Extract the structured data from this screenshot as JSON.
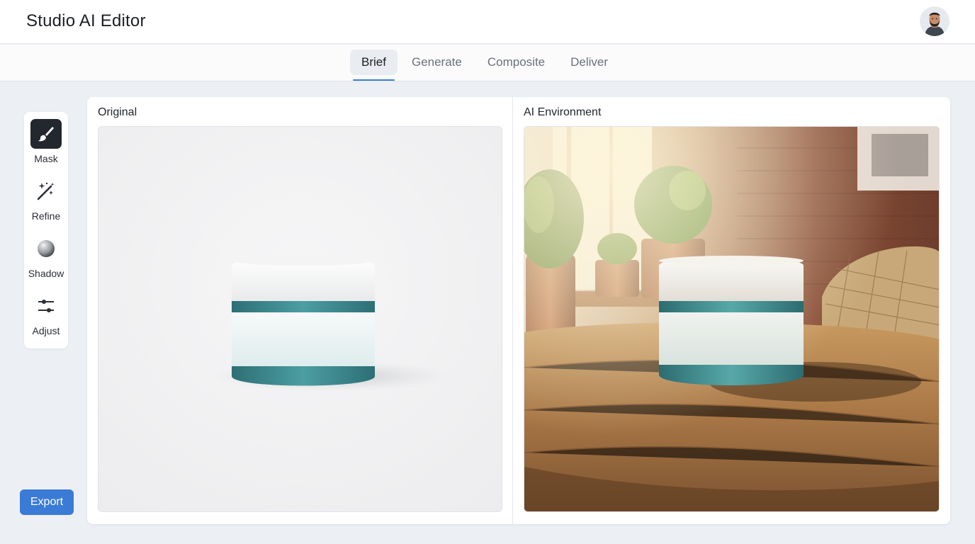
{
  "app": {
    "title": "Studio AI Editor"
  },
  "user": {
    "avatar_icon": "user-avatar"
  },
  "tabs": [
    {
      "label": "Brief",
      "active": true
    },
    {
      "label": "Generate",
      "active": false
    },
    {
      "label": "Composite",
      "active": false
    },
    {
      "label": "Deliver",
      "active": false
    }
  ],
  "tools": [
    {
      "label": "Mask",
      "icon": "brush-icon",
      "active": true
    },
    {
      "label": "Refine",
      "icon": "magic-wand-icon",
      "active": false
    },
    {
      "label": "Shadow",
      "icon": "shadow-sphere-icon",
      "active": false
    },
    {
      "label": "Adjust",
      "icon": "sliders-icon",
      "active": false
    }
  ],
  "actions": {
    "export_label": "Export"
  },
  "panels": {
    "original": {
      "label": "Original",
      "content": "product jar on white background"
    },
    "ai": {
      "label": "AI Environment",
      "content": "product jar on wooden table in sunlit room with potted plants"
    }
  },
  "colors": {
    "accent": "#3a7bd5",
    "active_tool": "#23272e",
    "jar_teal": "#3d8c92"
  }
}
